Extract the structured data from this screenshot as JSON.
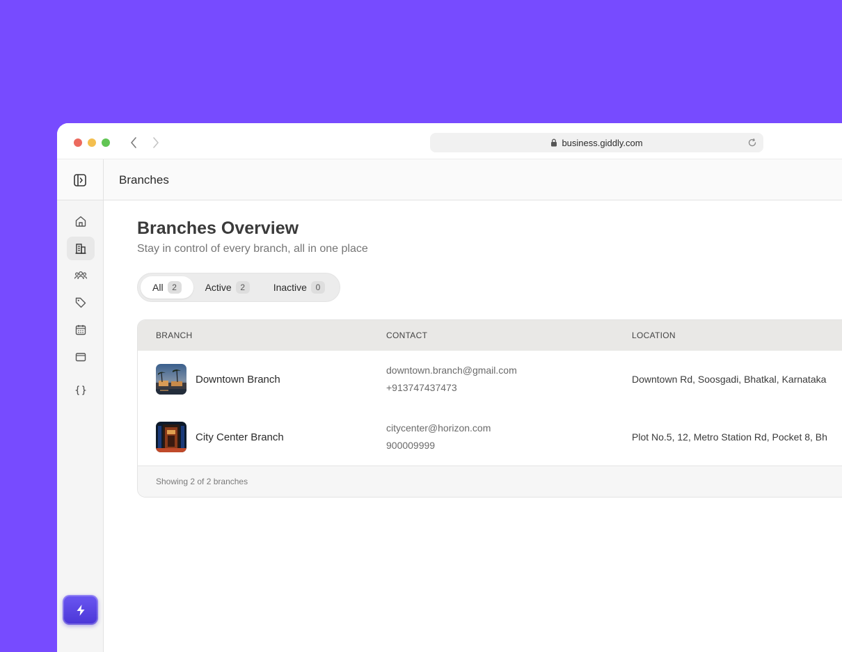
{
  "browser": {
    "url": "business.giddly.com"
  },
  "topbar": {
    "title": "Branches"
  },
  "sidebar": {
    "items": [
      {
        "name": "home",
        "icon": "home-icon"
      },
      {
        "name": "branches",
        "icon": "building-icon",
        "active": true
      },
      {
        "name": "team",
        "icon": "users-icon"
      },
      {
        "name": "tags",
        "icon": "tag-icon"
      },
      {
        "name": "calendar",
        "icon": "calendar-icon"
      },
      {
        "name": "wallet",
        "icon": "wallet-icon"
      },
      {
        "name": "integrations",
        "icon": "code-braces-icon"
      }
    ],
    "action_icon": "lightning-icon"
  },
  "page": {
    "title": "Branches Overview",
    "subtitle": "Stay in control of every branch, all in one place"
  },
  "filters": [
    {
      "label": "All",
      "count": "2",
      "active": true
    },
    {
      "label": "Active",
      "count": "2",
      "active": false
    },
    {
      "label": "Inactive",
      "count": "0",
      "active": false
    }
  ],
  "table": {
    "headers": {
      "branch": "BRANCH",
      "contact": "CONTACT",
      "location": "LOCATION"
    },
    "rows": [
      {
        "name": "Downtown Branch",
        "email": "downtown.branch@gmail.com",
        "phone": "+913747437473",
        "location": "Downtown Rd, Soosgadi, Bhatkal, Karnataka"
      },
      {
        "name": "City Center Branch",
        "email": "citycenter@horizon.com",
        "phone": "900009999",
        "location": "Plot No.5, 12, Metro Station Rd, Pocket 8, Bh"
      }
    ],
    "footer": "Showing 2 of 2 branches"
  },
  "colors": {
    "background": "#774bff",
    "accent": "#5a44e4"
  }
}
